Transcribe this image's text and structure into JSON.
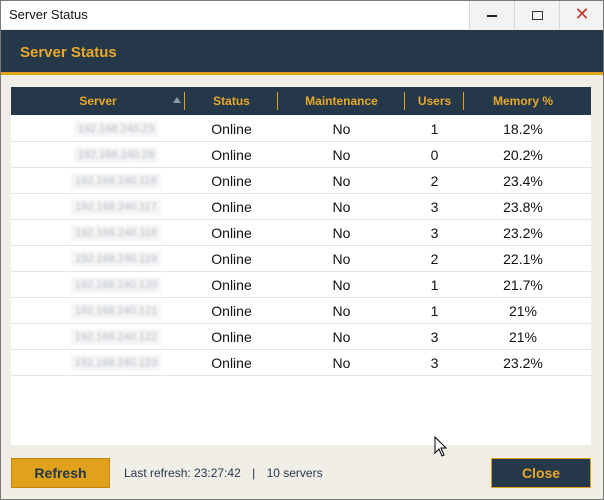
{
  "window": {
    "title": "Server Status",
    "controls": {
      "minimize_icon": "minimize-icon",
      "maximize_icon": "maximize-icon",
      "close_glyph": "✕"
    }
  },
  "header": {
    "title": "Server Status"
  },
  "table": {
    "columns": [
      "Server",
      "Status",
      "Maintenance",
      "Users",
      "Memory %"
    ],
    "sort_column": "Server",
    "rows": [
      {
        "server": "192.168.240.23",
        "status": "Online",
        "maintenance": "No",
        "users": "1",
        "memory": "18.2%"
      },
      {
        "server": "192.168.240.28",
        "status": "Online",
        "maintenance": "No",
        "users": "0",
        "memory": "20.2%"
      },
      {
        "server": "192.168.240.116",
        "status": "Online",
        "maintenance": "No",
        "users": "2",
        "memory": "23.4%"
      },
      {
        "server": "192.168.240.117",
        "status": "Online",
        "maintenance": "No",
        "users": "3",
        "memory": "23.8%"
      },
      {
        "server": "192.168.240.118",
        "status": "Online",
        "maintenance": "No",
        "users": "3",
        "memory": "23.2%"
      },
      {
        "server": "192.168.240.119",
        "status": "Online",
        "maintenance": "No",
        "users": "2",
        "memory": "22.1%"
      },
      {
        "server": "192.168.240.120",
        "status": "Online",
        "maintenance": "No",
        "users": "1",
        "memory": "21.7%"
      },
      {
        "server": "192.168.240.121",
        "status": "Online",
        "maintenance": "No",
        "users": "1",
        "memory": "21%"
      },
      {
        "server": "192.168.240.122",
        "status": "Online",
        "maintenance": "No",
        "users": "3",
        "memory": "21%"
      },
      {
        "server": "192.168.240.123",
        "status": "Online",
        "maintenance": "No",
        "users": "3",
        "memory": "23.2%"
      }
    ]
  },
  "footer": {
    "refresh_label": "Refresh",
    "last_refresh": "Last refresh: 23:27:42",
    "separator": "|",
    "server_count": "10 servers",
    "close_label": "Close"
  },
  "colors": {
    "navy": "#25384a",
    "accent": "#e0a11b",
    "background": "#f1eee8"
  }
}
